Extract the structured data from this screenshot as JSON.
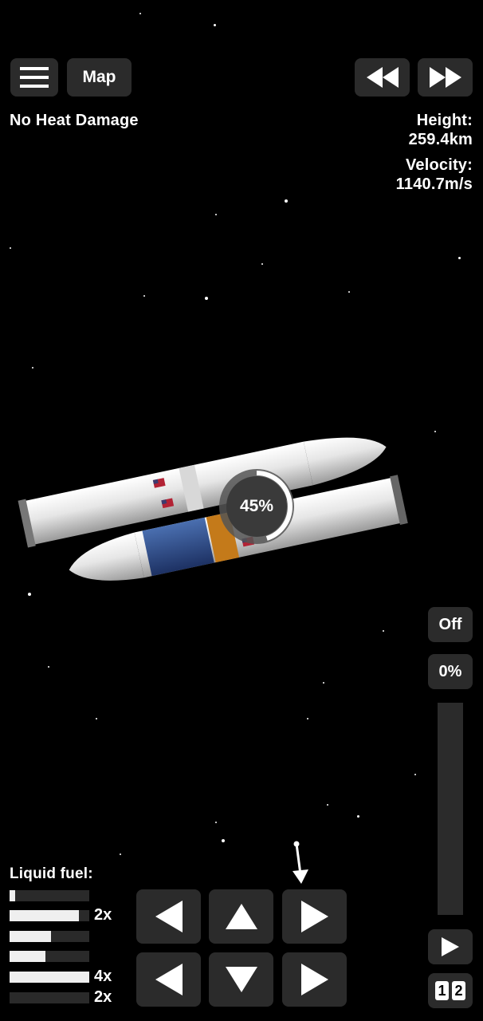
{
  "toolbar": {
    "menu_icon": "hamburger-icon",
    "map_label": "Map",
    "rewind_icon": "rewind-icon",
    "fast_forward_icon": "fast-forward-icon"
  },
  "status": {
    "heat": "No Heat Damage",
    "height_label": "Height:",
    "height_value": "259.4km",
    "velocity_label": "Velocity:",
    "velocity_value": "1140.7m/s"
  },
  "progress": {
    "label": "45%",
    "value": 0.45
  },
  "throttle": {
    "engine_toggle": "Off",
    "percent": "0%",
    "level": 0,
    "play_icon": "play-icon",
    "stage_digit_1": "1",
    "stage_digit_2": "2"
  },
  "fuel": {
    "title": "Liquid fuel:",
    "bars": [
      {
        "level": 0.07,
        "multiplier": ""
      },
      {
        "level": 0.87,
        "multiplier": "2x"
      },
      {
        "level": 0.52,
        "multiplier": ""
      },
      {
        "level": 0.45,
        "multiplier": ""
      },
      {
        "level": 1.0,
        "multiplier": "4x"
      },
      {
        "level": 0.0,
        "multiplier": "2x"
      }
    ]
  },
  "controls": {
    "row1": [
      "arrow-left-icon",
      "arrow-up-icon",
      "arrow-right-icon"
    ],
    "row2": [
      "arrow-left-icon",
      "arrow-down-icon",
      "arrow-right-icon"
    ],
    "direction_marker_icon": "direction-arrow-icon"
  }
}
